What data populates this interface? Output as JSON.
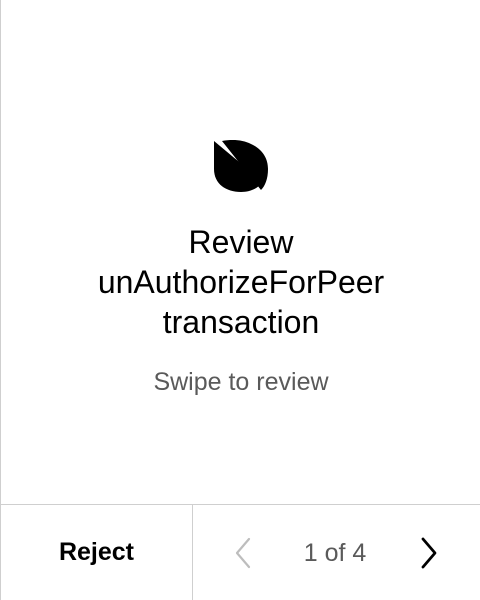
{
  "app": {
    "icon": "ontology-icon"
  },
  "review": {
    "title_line1": "Review",
    "title_line2": "unAuthorizeForPeer",
    "title_line3": "transaction",
    "subtitle": "Swipe to review"
  },
  "footer": {
    "reject_label": "Reject",
    "page_indicator": "1 of 4",
    "current_page": 1,
    "total_pages": 4
  },
  "colors": {
    "background": "#ffffff",
    "text_primary": "#000000",
    "text_secondary": "#5a5a5a",
    "divider": "#cfcfcf",
    "disabled_icon": "#bdbdbd"
  }
}
